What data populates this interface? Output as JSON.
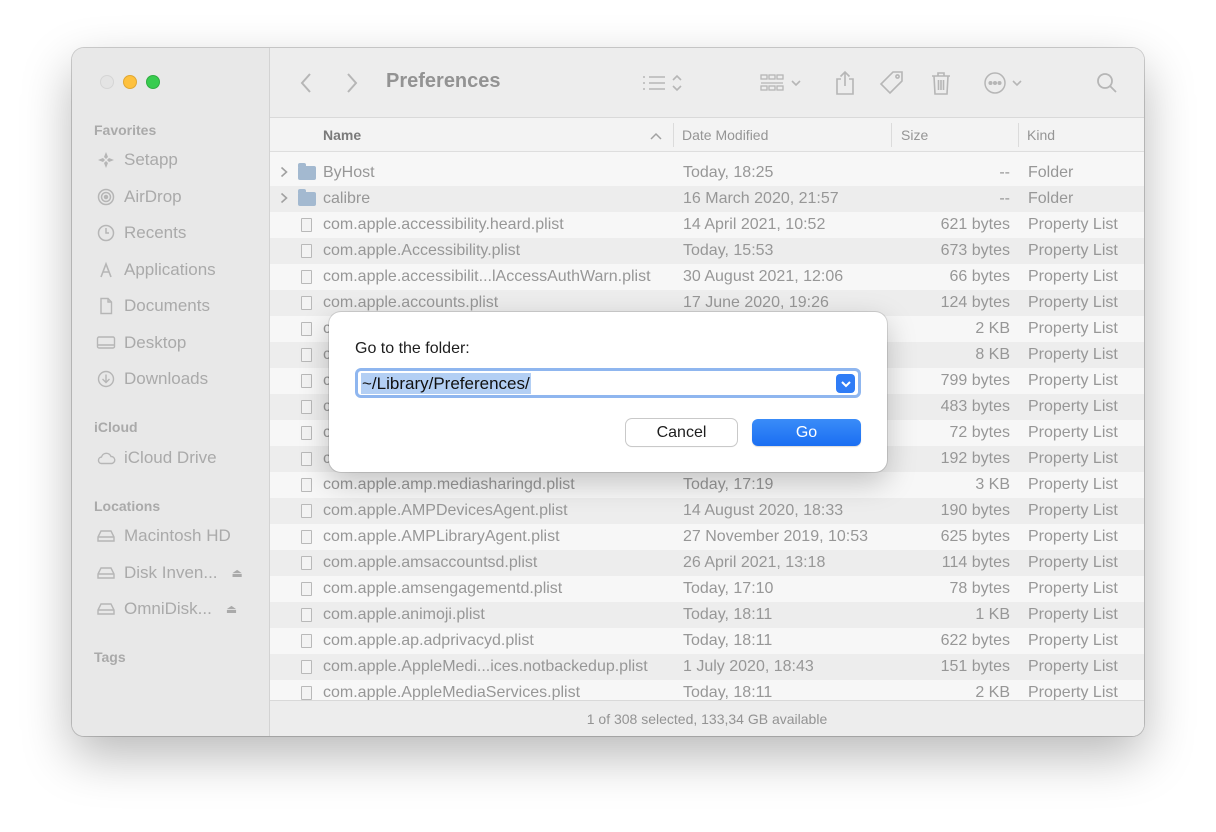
{
  "window": {
    "title": "Preferences"
  },
  "sidebar": {
    "sections": {
      "favorites": "Favorites",
      "icloud": "iCloud",
      "locations": "Locations",
      "tags": "Tags"
    },
    "favorites": [
      {
        "label": "Setapp",
        "icon": "setapp-icon"
      },
      {
        "label": "AirDrop",
        "icon": "airdrop-icon"
      },
      {
        "label": "Recents",
        "icon": "clock-icon"
      },
      {
        "label": "Applications",
        "icon": "applications-icon"
      },
      {
        "label": "Documents",
        "icon": "document-icon"
      },
      {
        "label": "Desktop",
        "icon": "desktop-icon"
      },
      {
        "label": "Downloads",
        "icon": "download-icon"
      }
    ],
    "icloud": [
      {
        "label": "iCloud Drive",
        "icon": "cloud-icon"
      }
    ],
    "locations": [
      {
        "label": "Macintosh HD",
        "icon": "drive-icon"
      },
      {
        "label": "Disk Inven...",
        "icon": "drive-icon"
      },
      {
        "label": "OmniDisk...",
        "icon": "drive-icon"
      }
    ]
  },
  "columns": {
    "name": "Name",
    "date": "Date Modified",
    "size": "Size",
    "kind": "Kind"
  },
  "files": [
    {
      "name": "ByHost",
      "date": "Today, 18:25",
      "size": "--",
      "kind": "Folder",
      "folder": true
    },
    {
      "name": "calibre",
      "date": "16 March 2020, 21:57",
      "size": "--",
      "kind": "Folder",
      "folder": true
    },
    {
      "name": "com.apple.accessibility.heard.plist",
      "date": "14 April 2021, 10:52",
      "size": "621 bytes",
      "kind": "Property List"
    },
    {
      "name": "com.apple.Accessibility.plist",
      "date": "Today, 15:53",
      "size": "673 bytes",
      "kind": "Property List"
    },
    {
      "name": "com.apple.accessibilit...lAccessAuthWarn.plist",
      "date": "30 August 2021, 12:06",
      "size": "66 bytes",
      "kind": "Property List"
    },
    {
      "name": "com.apple.accounts.plist",
      "date": "17 June 2020, 19:26",
      "size": "124 bytes",
      "kind": "Property List"
    },
    {
      "name": "c",
      "date": "",
      "size": "2 KB",
      "kind": "Property List"
    },
    {
      "name": "c",
      "date": "",
      "size": "8 KB",
      "kind": "Property List"
    },
    {
      "name": "c",
      "date": "",
      "size": "799 bytes",
      "kind": "Property List"
    },
    {
      "name": "c",
      "date": "",
      "size": "483 bytes",
      "kind": "Property List"
    },
    {
      "name": "c",
      "date": "",
      "size": "72 bytes",
      "kind": "Property List"
    },
    {
      "name": "c",
      "date": "",
      "size": "192 bytes",
      "kind": "Property List"
    },
    {
      "name": "com.apple.amp.mediasharingd.plist",
      "date": "Today, 17:19",
      "size": "3 KB",
      "kind": "Property List"
    },
    {
      "name": "com.apple.AMPDevicesAgent.plist",
      "date": "14 August 2020, 18:33",
      "size": "190 bytes",
      "kind": "Property List"
    },
    {
      "name": "com.apple.AMPLibraryAgent.plist",
      "date": "27 November 2019, 10:53",
      "size": "625 bytes",
      "kind": "Property List"
    },
    {
      "name": "com.apple.amsaccountsd.plist",
      "date": "26 April 2021, 13:18",
      "size": "114 bytes",
      "kind": "Property List"
    },
    {
      "name": "com.apple.amsengagementd.plist",
      "date": "Today, 17:10",
      "size": "78 bytes",
      "kind": "Property List"
    },
    {
      "name": "com.apple.animoji.plist",
      "date": "Today, 18:11",
      "size": "1 KB",
      "kind": "Property List"
    },
    {
      "name": "com.apple.ap.adprivacyd.plist",
      "date": "Today, 18:11",
      "size": "622 bytes",
      "kind": "Property List"
    },
    {
      "name": "com.apple.AppleMedi...ices.notbackedup.plist",
      "date": "1 July 2020, 18:43",
      "size": "151 bytes",
      "kind": "Property List"
    },
    {
      "name": "com.apple.AppleMediaServices.plist",
      "date": "Today, 18:11",
      "size": "2 KB",
      "kind": "Property List"
    }
  ],
  "status": {
    "text": "1 of 308 selected, 133,34 GB available"
  },
  "dialog": {
    "label": "Go to the folder:",
    "value": "~/Library/Preferences/",
    "cancel_label": "Cancel",
    "go_label": "Go"
  },
  "colors": {
    "accent": "#2f7cf6",
    "selection": "#b3cff4",
    "folder": "#9cb4cc"
  }
}
